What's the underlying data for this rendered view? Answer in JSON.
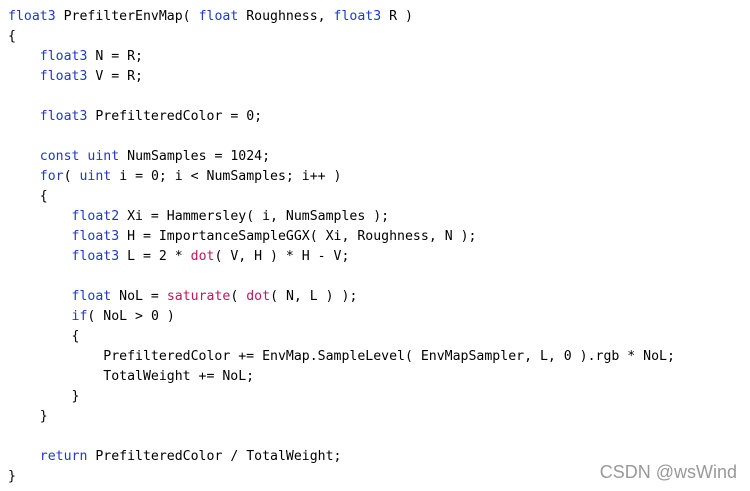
{
  "code_lines": [
    [
      {
        "t": "float3",
        "c": "kw"
      },
      {
        "t": " PrefilterEnvMap( ",
        "c": ""
      },
      {
        "t": "float",
        "c": "kw"
      },
      {
        "t": " Roughness, ",
        "c": ""
      },
      {
        "t": "float3",
        "c": "kw"
      },
      {
        "t": " R )",
        "c": ""
      }
    ],
    [
      {
        "t": "{",
        "c": ""
      }
    ],
    [
      {
        "t": "    ",
        "c": ""
      },
      {
        "t": "float3",
        "c": "kw"
      },
      {
        "t": " N = R;",
        "c": ""
      }
    ],
    [
      {
        "t": "    ",
        "c": ""
      },
      {
        "t": "float3",
        "c": "kw"
      },
      {
        "t": " V = R;",
        "c": ""
      }
    ],
    [],
    [
      {
        "t": "    ",
        "c": ""
      },
      {
        "t": "float3",
        "c": "kw"
      },
      {
        "t": " PrefilteredColor = 0;",
        "c": ""
      }
    ],
    [],
    [
      {
        "t": "    ",
        "c": ""
      },
      {
        "t": "const",
        "c": "kw"
      },
      {
        "t": " ",
        "c": ""
      },
      {
        "t": "uint",
        "c": "kw"
      },
      {
        "t": " NumSamples = 1024;",
        "c": ""
      }
    ],
    [
      {
        "t": "    ",
        "c": ""
      },
      {
        "t": "for",
        "c": "kw"
      },
      {
        "t": "( ",
        "c": ""
      },
      {
        "t": "uint",
        "c": "kw"
      },
      {
        "t": " i = 0; i < NumSamples; i++ )",
        "c": ""
      }
    ],
    [
      {
        "t": "    {",
        "c": ""
      }
    ],
    [
      {
        "t": "        ",
        "c": ""
      },
      {
        "t": "float2",
        "c": "kw"
      },
      {
        "t": " Xi = Hammersley( i, NumSamples );",
        "c": ""
      }
    ],
    [
      {
        "t": "        ",
        "c": ""
      },
      {
        "t": "float3",
        "c": "kw"
      },
      {
        "t": " H = ImportanceSampleGGX( Xi, Roughness, N );",
        "c": ""
      }
    ],
    [
      {
        "t": "        ",
        "c": ""
      },
      {
        "t": "float3",
        "c": "kw"
      },
      {
        "t": " L = 2 * ",
        "c": ""
      },
      {
        "t": "dot",
        "c": "fn"
      },
      {
        "t": "( V, H ) * H - V;",
        "c": ""
      }
    ],
    [],
    [
      {
        "t": "        ",
        "c": ""
      },
      {
        "t": "float",
        "c": "kw"
      },
      {
        "t": " NoL = ",
        "c": ""
      },
      {
        "t": "saturate",
        "c": "fn"
      },
      {
        "t": "( ",
        "c": ""
      },
      {
        "t": "dot",
        "c": "fn"
      },
      {
        "t": "( N, L ) );",
        "c": ""
      }
    ],
    [
      {
        "t": "        ",
        "c": ""
      },
      {
        "t": "if",
        "c": "kw"
      },
      {
        "t": "( NoL > 0 )",
        "c": ""
      }
    ],
    [
      {
        "t": "        {",
        "c": ""
      }
    ],
    [
      {
        "t": "            PrefilteredColor += EnvMap.SampleLevel( EnvMapSampler, L, 0 ).rgb * NoL;",
        "c": ""
      }
    ],
    [
      {
        "t": "            TotalWeight += NoL;",
        "c": ""
      }
    ],
    [
      {
        "t": "        }",
        "c": ""
      }
    ],
    [
      {
        "t": "    }",
        "c": ""
      }
    ],
    [],
    [
      {
        "t": "    ",
        "c": ""
      },
      {
        "t": "return",
        "c": "kw"
      },
      {
        "t": " PrefilteredColor / TotalWeight;",
        "c": ""
      }
    ],
    [
      {
        "t": "}",
        "c": ""
      }
    ]
  ],
  "colors": {
    "keyword": "#1f39c9",
    "function": "#c0165a",
    "text": "#000000",
    "watermark": "#999999"
  },
  "watermark": "CSDN @wsWind"
}
